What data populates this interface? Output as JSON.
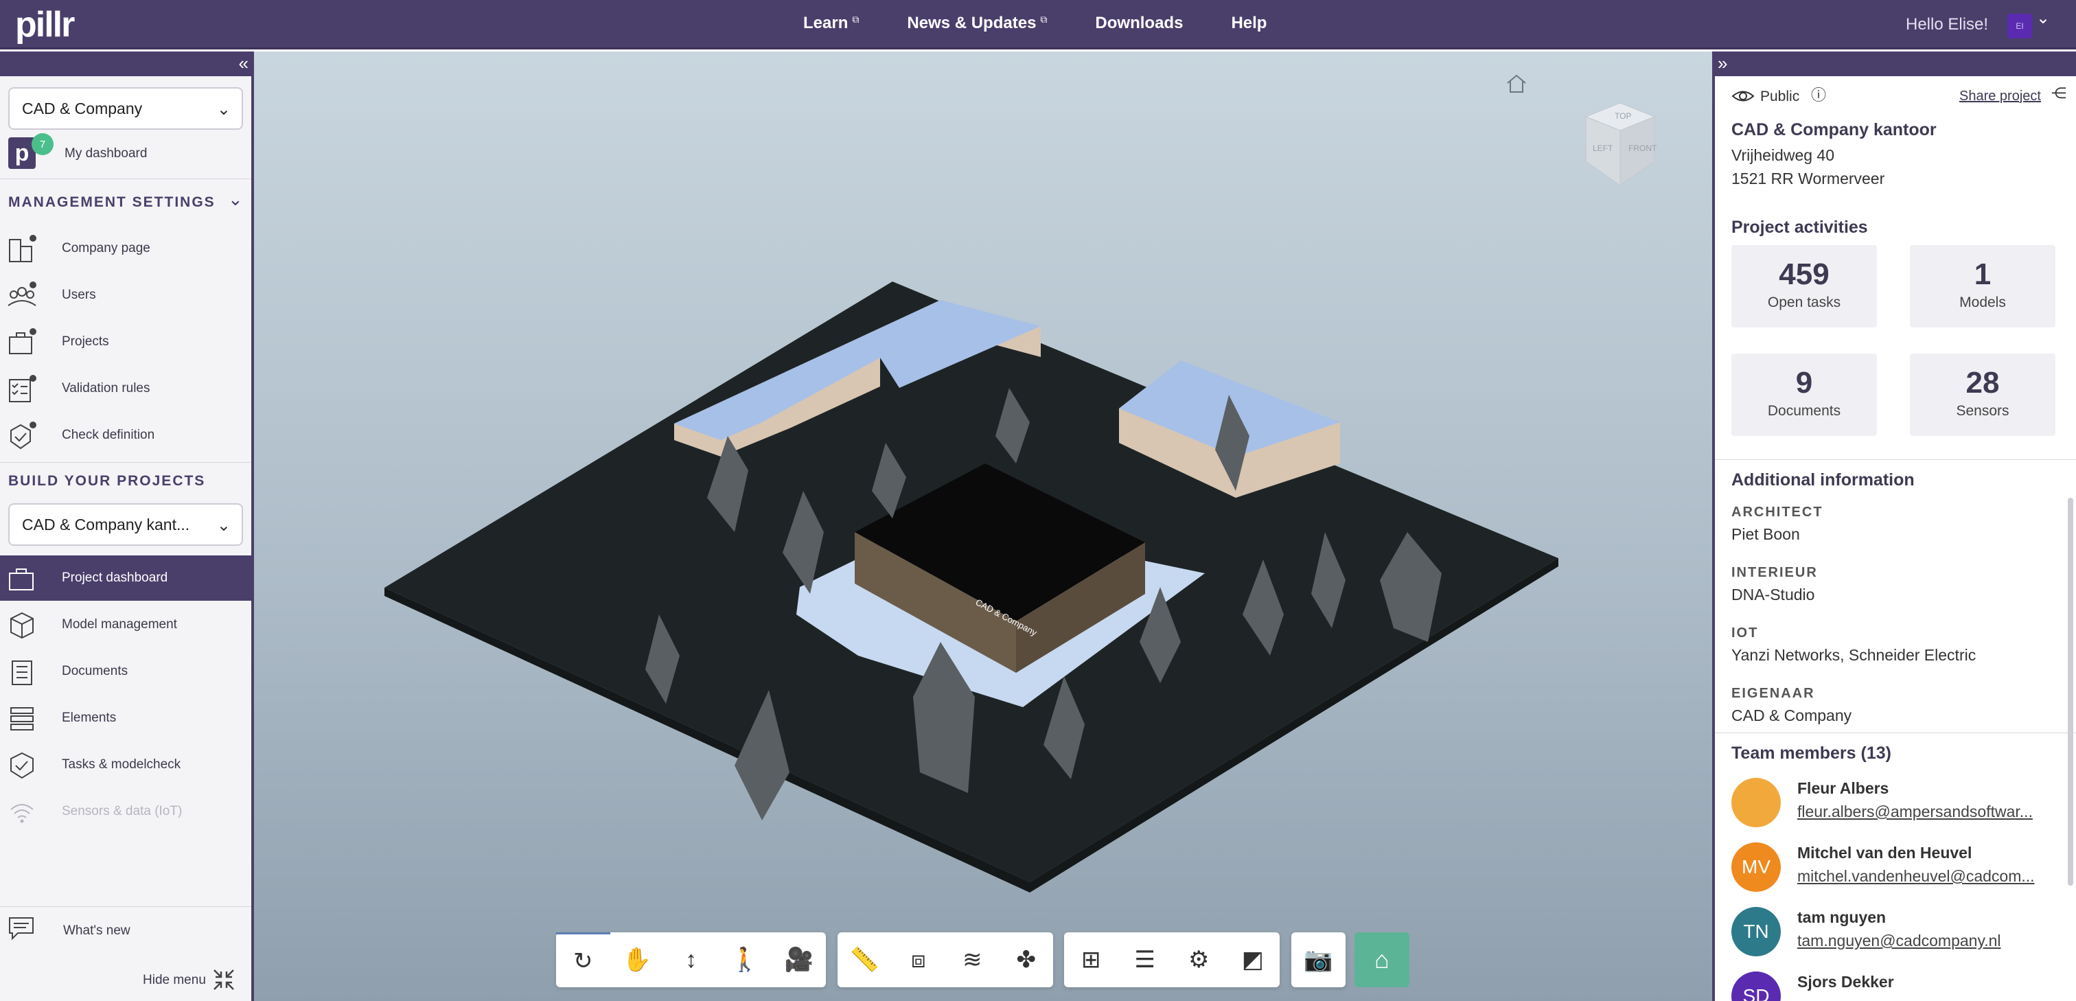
{
  "app": {
    "logo": "pillr"
  },
  "topnav": {
    "items": [
      {
        "label": "Learn",
        "external": "⧉"
      },
      {
        "label": "News & Updates",
        "external": "⧉"
      },
      {
        "label": "Downloads",
        "external": ""
      },
      {
        "label": "Help",
        "external": ""
      }
    ],
    "greeting": "Hello Elise!",
    "avatar_initials": "EI"
  },
  "sidebar": {
    "company_select": "CAD & Company",
    "dashboard_badge": "7",
    "my_dashboard": "My dashboard",
    "management_title": "MANAGEMENT SETTINGS",
    "management_items": [
      {
        "label": "Company page"
      },
      {
        "label": "Users"
      },
      {
        "label": "Projects"
      },
      {
        "label": "Validation rules"
      },
      {
        "label": "Check definition"
      }
    ],
    "build_title": "BUILD YOUR PROJECTS",
    "project_select": "CAD & Company kant...",
    "build_items": [
      {
        "label": "Project dashboard",
        "active": true
      },
      {
        "label": "Model management"
      },
      {
        "label": "Documents"
      },
      {
        "label": "Elements"
      },
      {
        "label": "Tasks & modelcheck"
      },
      {
        "label": "Sensors & data (IoT)",
        "disabled": true
      }
    ],
    "whats_new": "What's new",
    "hide_menu": "Hide menu"
  },
  "viewport": {
    "navcube": {
      "top": "TOP",
      "left": "LEFT",
      "front": "FRONT"
    },
    "building_sign": "CAD & Company"
  },
  "right": {
    "visibility": "Public",
    "share": "Share project",
    "project_name": "CAD & Company kantoor",
    "address_line1": "Vrijheidweg 40",
    "address_line2": "1521 RR Wormerveer",
    "activities_title": "Project activities",
    "stats": [
      {
        "value": "459",
        "label": "Open tasks"
      },
      {
        "value": "1",
        "label": "Models"
      },
      {
        "value": "9",
        "label": "Documents"
      },
      {
        "value": "28",
        "label": "Sensors"
      }
    ],
    "additional_title": "Additional information",
    "info": [
      {
        "label": "ARCHITECT",
        "value": "Piet Boon"
      },
      {
        "label": "INTERIEUR",
        "value": "DNA-Studio"
      },
      {
        "label": "IOT",
        "value": "Yanzi Networks, Schneider Electric"
      },
      {
        "label": "EIGENAAR",
        "value": "CAD & Company"
      }
    ],
    "team_title": "Team members (13)",
    "members": [
      {
        "name": "Fleur Albers",
        "email": "fleur.albers@ampersandsoftwar...",
        "initials": "",
        "color": "#f2a93b"
      },
      {
        "name": "Mitchel van den Heuvel",
        "email": "mitchel.vandenheuvel@cadcom...",
        "initials": "MV",
        "color": "#ef8a1f"
      },
      {
        "name": "tam nguyen",
        "email": "tam.nguyen@cadcompany.nl",
        "initials": "TN",
        "color": "#2c7a8a"
      },
      {
        "name": "Sjors Dekker",
        "email": "",
        "initials": "SD",
        "color": "#5a2bb0"
      }
    ]
  }
}
